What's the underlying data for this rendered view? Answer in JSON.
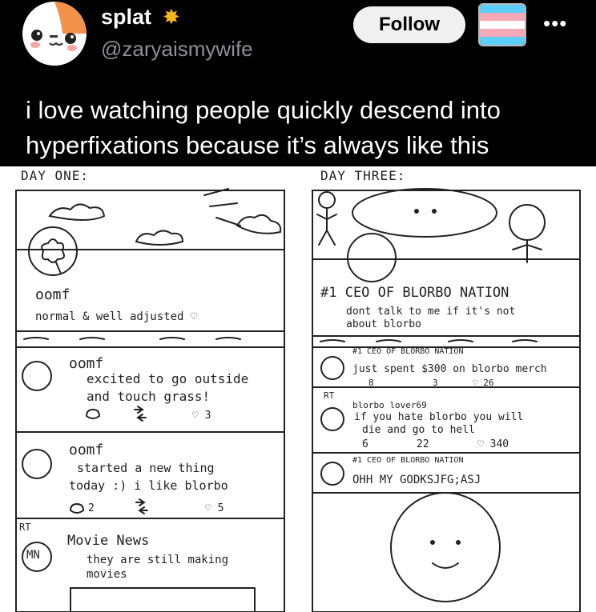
{
  "tweet": {
    "author_name": "splat",
    "author_emoji": "sun-icon",
    "handle": "@zaryaismywife",
    "follow_label": "Follow",
    "more_icon": "more-icon",
    "text": "i love watching people quickly descend into hyperfixations because it’s always like this",
    "flag_colors": [
      "#5BCEFA",
      "#F5A9B8",
      "#FFFFFF",
      "#F5A9B8",
      "#5BCEFA"
    ]
  },
  "comic": {
    "left": {
      "title": "DAY ONE:",
      "profile_name": "oomf",
      "bio": "normal & well adjusted ♡",
      "posts": [
        {
          "author": "oomf",
          "text_lines": [
            "excited to go outside",
            "and touch grass!"
          ],
          "likes": "3"
        },
        {
          "author": "oomf",
          "text_lines": [
            "started a new thing",
            "today :) i like blorbo"
          ],
          "replies": "2",
          "likes": "5"
        }
      ],
      "rt_label": "RT",
      "rt_post": {
        "author": "Movie News",
        "avatar_text": "MN",
        "text_lines": [
          "they are still making",
          "movies"
        ]
      }
    },
    "right": {
      "title": "DAY THREE:",
      "profile_name": "#1 CEO OF BLORBO NATION",
      "bio_lines": [
        "dont talk to me if it's not",
        "about blorbo"
      ],
      "post1": {
        "author": "#1 CEO OF BLORBO NATION",
        "text": "just spent $300 on blorbo merch",
        "replies": "8",
        "retweets": "3",
        "likes": "26"
      },
      "rt_label": "RT",
      "post2": {
        "author": "blorbo lover69",
        "text_lines": [
          "if you hate blorbo you will",
          "die and go to hell"
        ],
        "replies": "6",
        "retweets": "22",
        "likes": "340"
      },
      "post3": {
        "author": "#1 CEO OF BLORBO NATION",
        "text": "OHH MY GODKSJFG;ASJ"
      }
    }
  }
}
